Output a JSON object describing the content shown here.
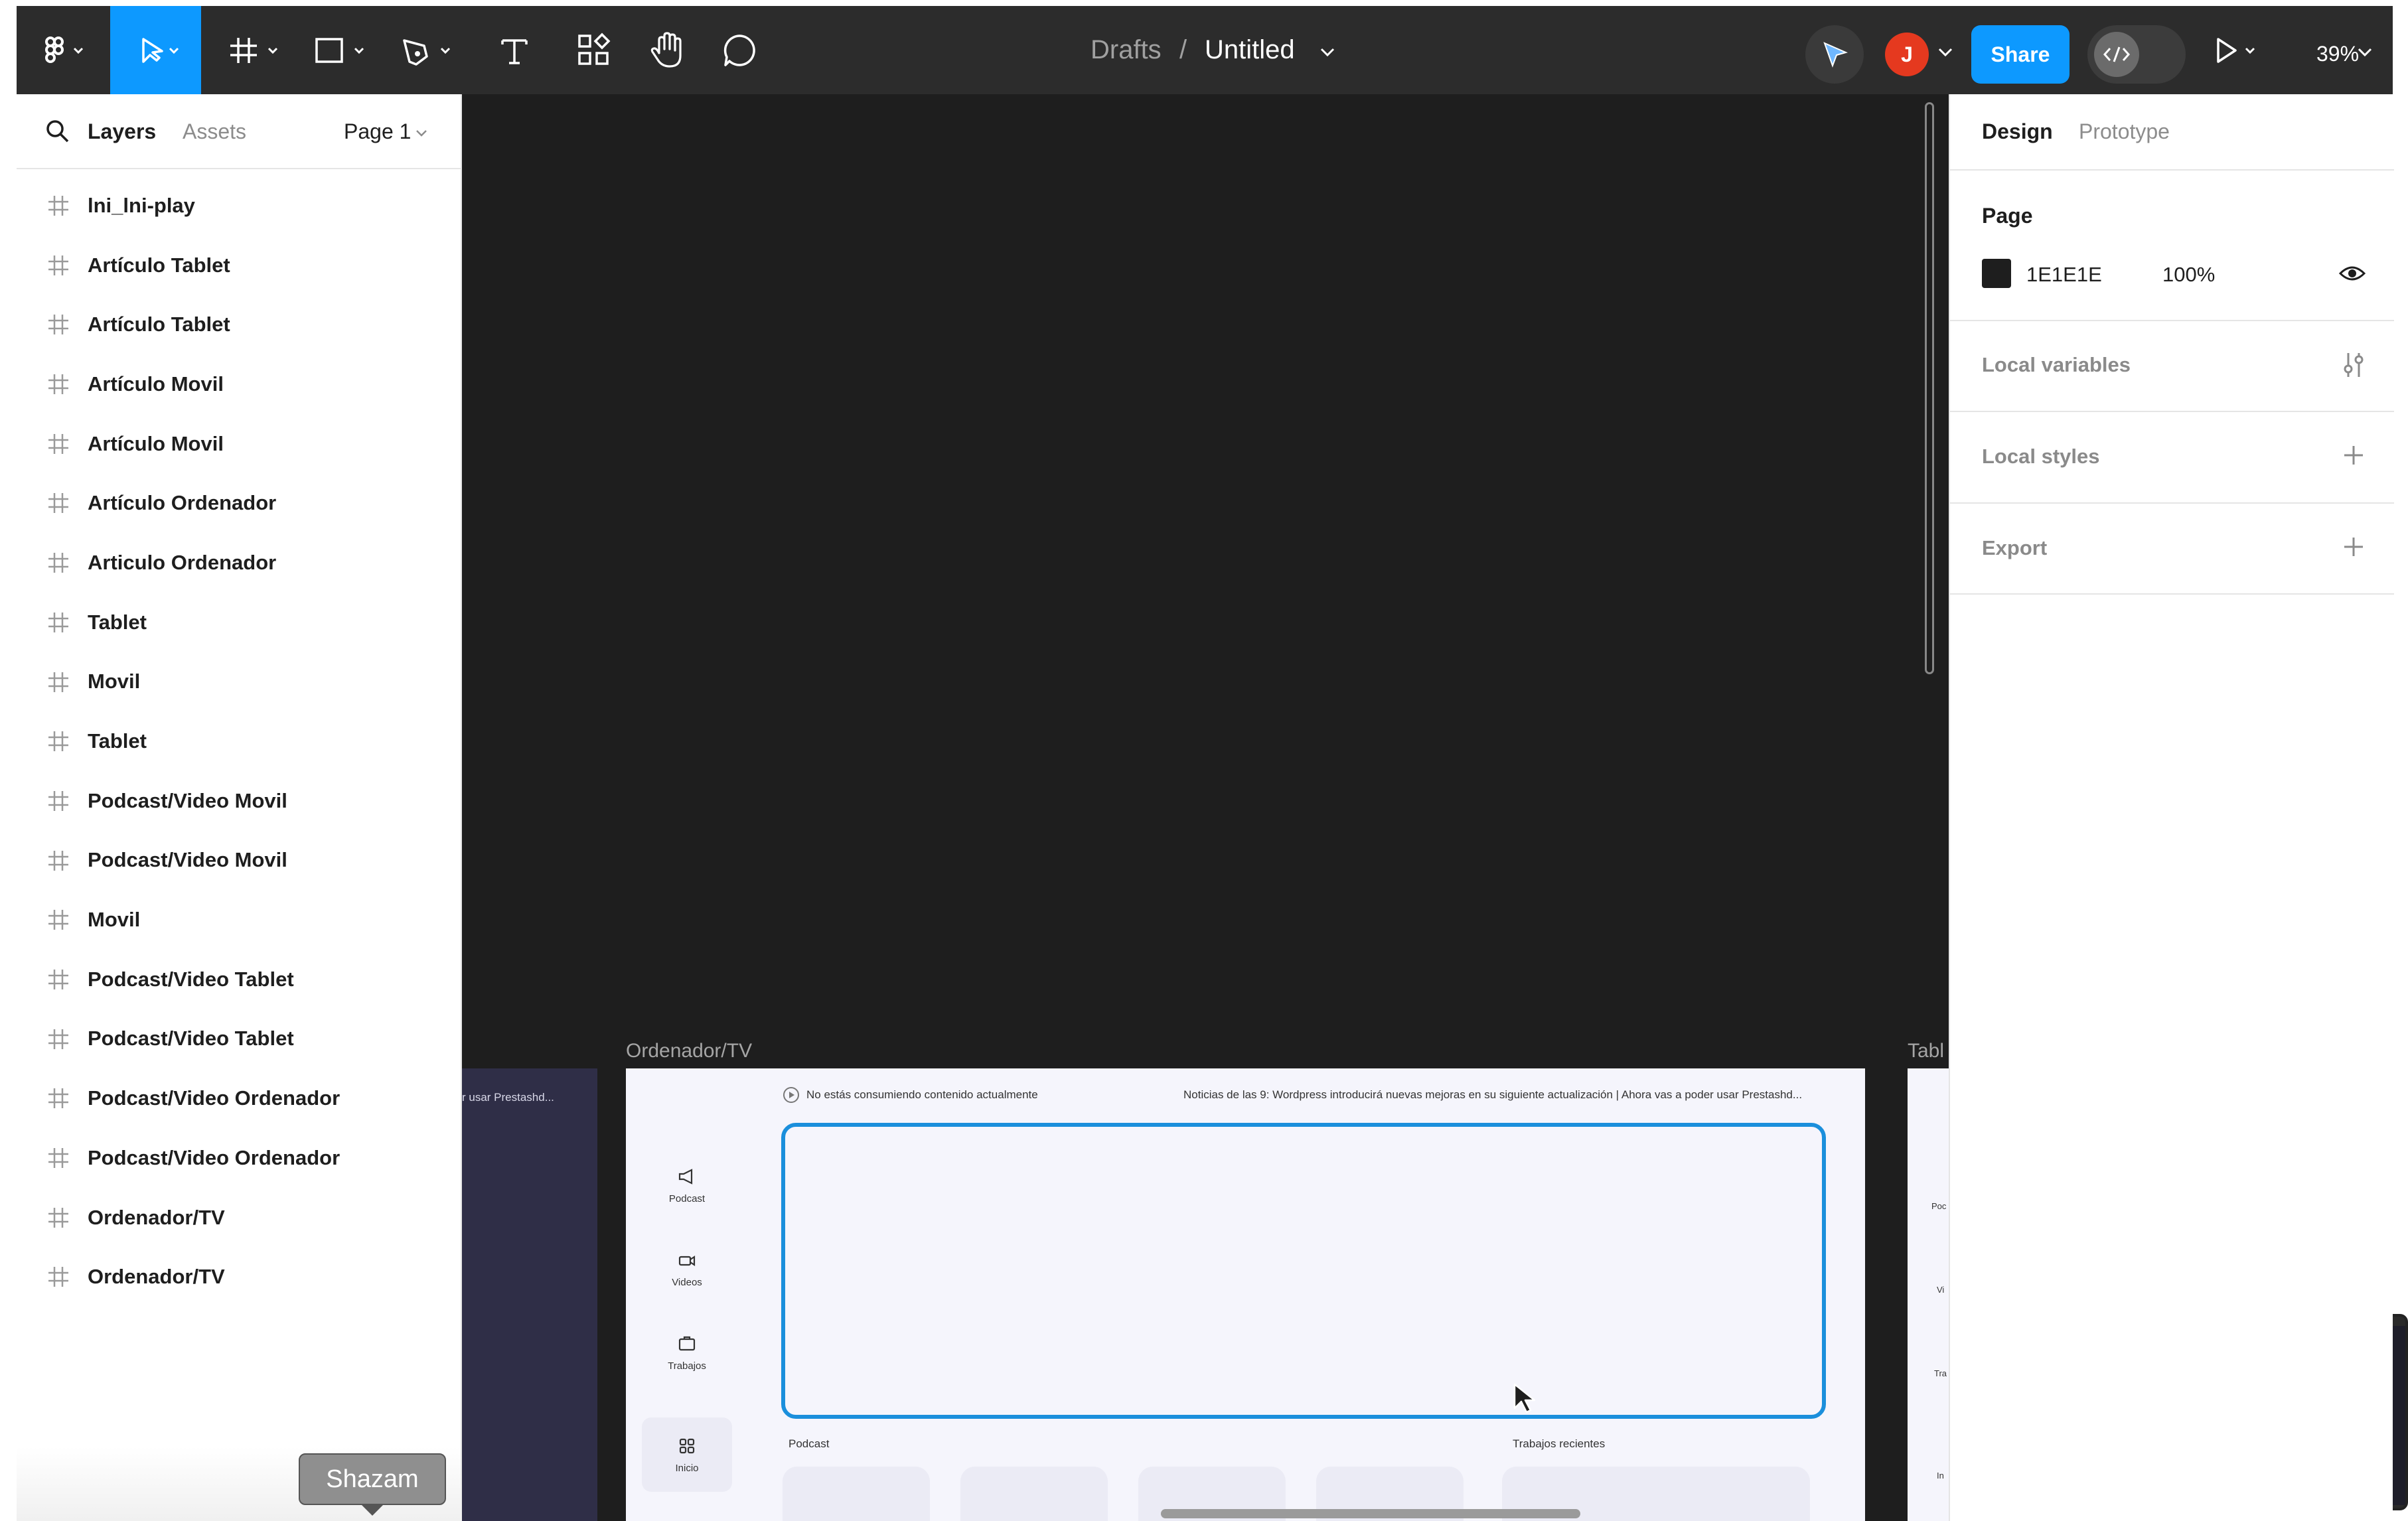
{
  "toolbar": {
    "breadcrumb_parent": "Drafts",
    "breadcrumb_separator": "/",
    "file_name": "Untitled",
    "share_label": "Share",
    "avatar_initial": "J",
    "zoom": "39%",
    "icons": [
      "figma-menu-icon",
      "move-tool-icon",
      "frame-tool-icon",
      "rectangle-tool-icon",
      "pen-tool-icon",
      "text-tool-icon",
      "resources-icon",
      "hand-tool-icon",
      "comment-icon",
      "cursor-chat-icon",
      "dev-mode-icon",
      "present-icon"
    ]
  },
  "left_panel": {
    "tabs": [
      "Layers",
      "Assets"
    ],
    "page_selector": "Page 1",
    "layers": [
      "lni_lni-play",
      "Artículo Tablet",
      "Artículo Tablet",
      "Artículo Movil",
      "Artículo Movil",
      "Artículo Ordenador",
      "Articulo Ordenador",
      "Tablet",
      "Movil",
      "Tablet",
      "Podcast/Video Movil",
      "Podcast/Video Movil",
      "Movil",
      "Podcast/Video Tablet",
      "Podcast/Video Tablet",
      "Podcast/Video Ordenador",
      "Podcast/Video Ordenador",
      "Ordenador/TV",
      "Ordenador/TV"
    ],
    "tooltip": "Shazam"
  },
  "canvas": {
    "background": "#1E1E1E",
    "frame_main_label": "Ordenador/TV",
    "frame_right_label": "Tabl",
    "frame_left_text": "r usar Prestashd...",
    "frame_main": {
      "now_playing": "No estás consumiendo contenido actualmente",
      "news_ticker": "Noticias de las 9: Wordpress introducirá nuevas mejoras en su siguiente actualización | Ahora vas a poder usar Prestashd...",
      "nav": [
        "Podcast",
        "Videos",
        "Trabajos",
        "Inicio"
      ],
      "section_podcast": "Podcast",
      "section_recent_jobs": "Trabajos recientes"
    },
    "frame_right_nav": [
      "Poc",
      "Vi",
      "Tra",
      "In"
    ]
  },
  "right_panel": {
    "tabs": [
      "Design",
      "Prototype"
    ],
    "page_heading": "Page",
    "page_color_hex": "1E1E1E",
    "page_opacity": "100%",
    "sections": [
      "Local variables",
      "Local styles",
      "Export"
    ]
  },
  "colors": {
    "toolbar_bg": "#2C2C2C",
    "accent": "#0D99FF",
    "canvas_bg": "#1E1E1E",
    "frame_selection": "#1B8FDC",
    "avatar": "#E5391F"
  }
}
